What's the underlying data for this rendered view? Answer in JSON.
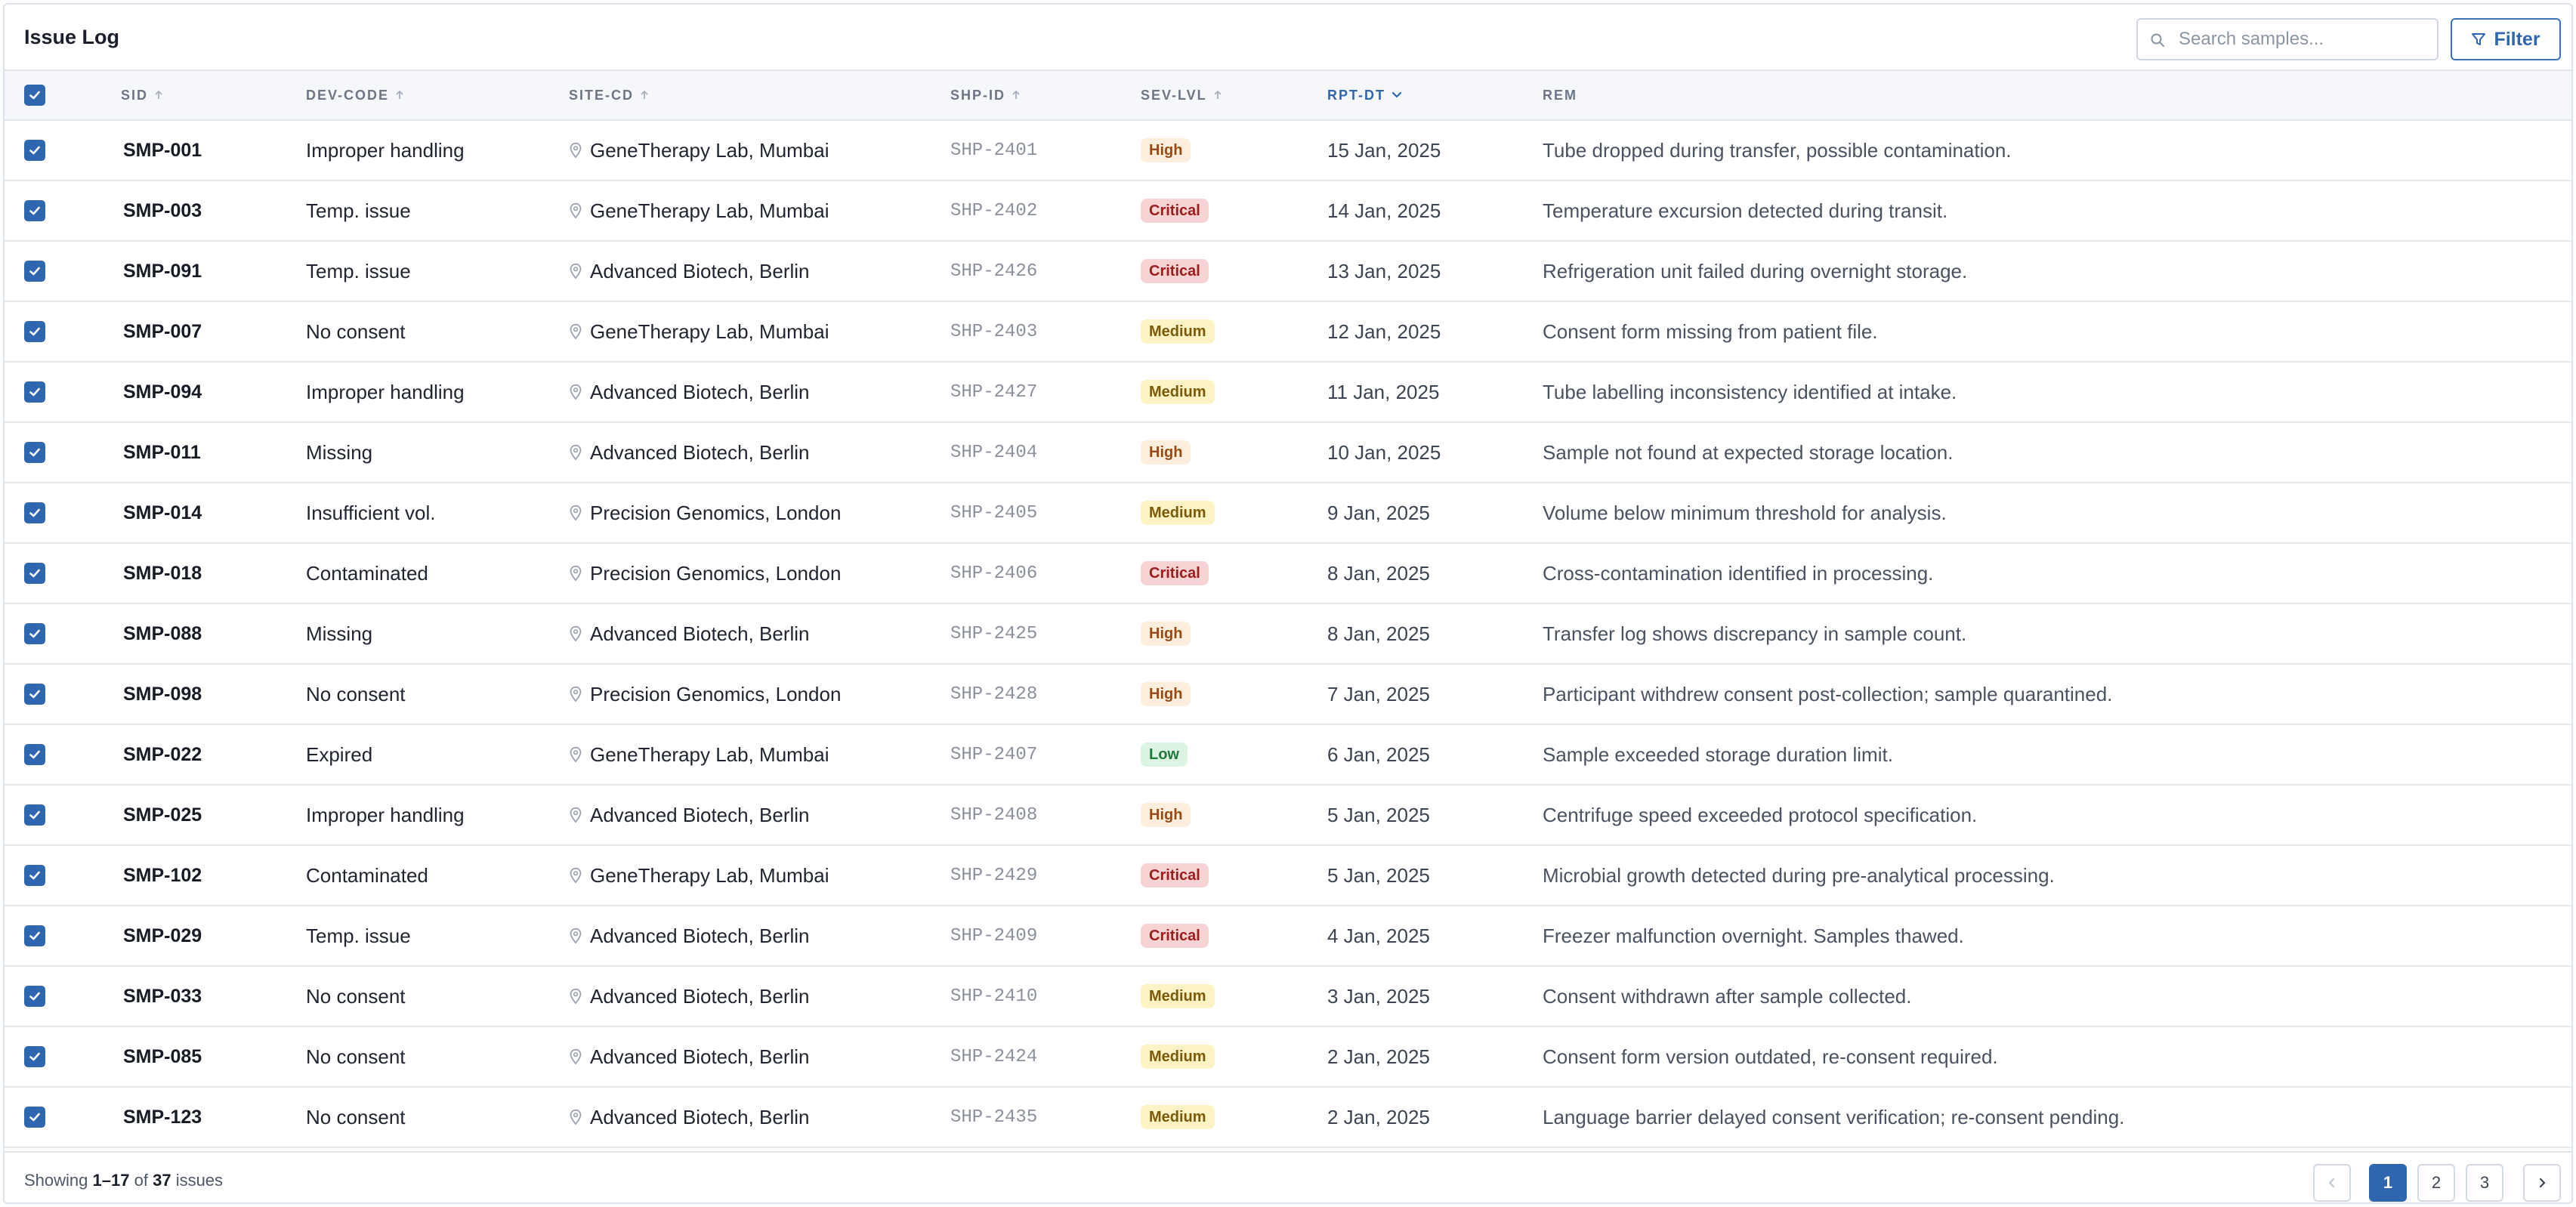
{
  "header": {
    "title": "Issue Log",
    "search_placeholder": "Search samples...",
    "filter_label": "Filter"
  },
  "columns": {
    "sid": "SID",
    "dev_code": "DEV-CODE",
    "site_cd": "SITE-CD",
    "shp_id": "SHP-ID",
    "sev_lvl": "SEV-LVL",
    "rpt_dt": "RPT-DT",
    "rem": "REM"
  },
  "sort": {
    "active_column": "RPT-DT",
    "direction": "descending"
  },
  "rows": [
    {
      "sid": "SMP-001",
      "dev": "Improper handling",
      "site": "GeneTherapy Lab, Mumbai",
      "shp": "SHP-2401",
      "sev": "High",
      "date": "15 Jan, 2025",
      "rem": "Tube dropped during transfer, possible contamination.",
      "checked": true
    },
    {
      "sid": "SMP-003",
      "dev": "Temp. issue",
      "site": "GeneTherapy Lab, Mumbai",
      "shp": "SHP-2402",
      "sev": "Critical",
      "date": "14 Jan, 2025",
      "rem": "Temperature excursion detected during transit.",
      "checked": true
    },
    {
      "sid": "SMP-091",
      "dev": "Temp. issue",
      "site": "Advanced Biotech, Berlin",
      "shp": "SHP-2426",
      "sev": "Critical",
      "date": "13 Jan, 2025",
      "rem": "Refrigeration unit failed during overnight storage.",
      "checked": true
    },
    {
      "sid": "SMP-007",
      "dev": "No consent",
      "site": "GeneTherapy Lab, Mumbai",
      "shp": "SHP-2403",
      "sev": "Medium",
      "date": "12 Jan, 2025",
      "rem": "Consent form missing from patient file.",
      "checked": true
    },
    {
      "sid": "SMP-094",
      "dev": "Improper handling",
      "site": "Advanced Biotech, Berlin",
      "shp": "SHP-2427",
      "sev": "Medium",
      "date": "11 Jan, 2025",
      "rem": "Tube labelling inconsistency identified at intake.",
      "checked": true
    },
    {
      "sid": "SMP-011",
      "dev": "Missing",
      "site": "Advanced Biotech, Berlin",
      "shp": "SHP-2404",
      "sev": "High",
      "date": "10 Jan, 2025",
      "rem": "Sample not found at expected storage location.",
      "checked": true
    },
    {
      "sid": "SMP-014",
      "dev": "Insufficient vol.",
      "site": "Precision Genomics, London",
      "shp": "SHP-2405",
      "sev": "Medium",
      "date": "9 Jan, 2025",
      "rem": "Volume below minimum threshold for analysis.",
      "checked": true
    },
    {
      "sid": "SMP-018",
      "dev": "Contaminated",
      "site": "Precision Genomics, London",
      "shp": "SHP-2406",
      "sev": "Critical",
      "date": "8 Jan, 2025",
      "rem": "Cross-contamination identified in processing.",
      "checked": true
    },
    {
      "sid": "SMP-088",
      "dev": "Missing",
      "site": "Advanced Biotech, Berlin",
      "shp": "SHP-2425",
      "sev": "High",
      "date": "8 Jan, 2025",
      "rem": "Transfer log shows discrepancy in sample count.",
      "checked": true
    },
    {
      "sid": "SMP-098",
      "dev": "No consent",
      "site": "Precision Genomics, London",
      "shp": "SHP-2428",
      "sev": "High",
      "date": "7 Jan, 2025",
      "rem": "Participant withdrew consent post-collection; sample quarantined.",
      "checked": true
    },
    {
      "sid": "SMP-022",
      "dev": "Expired",
      "site": "GeneTherapy Lab, Mumbai",
      "shp": "SHP-2407",
      "sev": "Low",
      "date": "6 Jan, 2025",
      "rem": "Sample exceeded storage duration limit.",
      "checked": true
    },
    {
      "sid": "SMP-025",
      "dev": "Improper handling",
      "site": "Advanced Biotech, Berlin",
      "shp": "SHP-2408",
      "sev": "High",
      "date": "5 Jan, 2025",
      "rem": "Centrifuge speed exceeded protocol specification.",
      "checked": true
    },
    {
      "sid": "SMP-102",
      "dev": "Contaminated",
      "site": "GeneTherapy Lab, Mumbai",
      "shp": "SHP-2429",
      "sev": "Critical",
      "date": "5 Jan, 2025",
      "rem": "Microbial growth detected during pre-analytical processing.",
      "checked": true
    },
    {
      "sid": "SMP-029",
      "dev": "Temp. issue",
      "site": "Advanced Biotech, Berlin",
      "shp": "SHP-2409",
      "sev": "Critical",
      "date": "4 Jan, 2025",
      "rem": "Freezer malfunction overnight. Samples thawed.",
      "checked": true
    },
    {
      "sid": "SMP-033",
      "dev": "No consent",
      "site": "Advanced Biotech, Berlin",
      "shp": "SHP-2410",
      "sev": "Medium",
      "date": "3 Jan, 2025",
      "rem": "Consent withdrawn after sample collected.",
      "checked": true
    },
    {
      "sid": "SMP-085",
      "dev": "No consent",
      "site": "Advanced Biotech, Berlin",
      "shp": "SHP-2424",
      "sev": "Medium",
      "date": "2 Jan, 2025",
      "rem": "Consent form version outdated, re-consent required.",
      "checked": true
    },
    {
      "sid": "SMP-123",
      "dev": "No consent",
      "site": "Advanced Biotech, Berlin",
      "shp": "SHP-2435",
      "sev": "Medium",
      "date": "2 Jan, 2025",
      "rem": "Language barrier delayed consent verification; re-consent pending.",
      "checked": true
    }
  ],
  "footer": {
    "showing_prefix": "Showing",
    "range": "1–17",
    "of": "of",
    "total": "37",
    "suffix": "issues"
  },
  "pagination": {
    "prev_icon": "chevron-left-icon",
    "pages": [
      "1",
      "2",
      "3"
    ],
    "current": "1",
    "next_icon": "chevron-right-icon"
  },
  "colors": {
    "accent": "#2e66b0",
    "high_bg": "#fdeedd",
    "critical_bg": "#f8d3d3",
    "medium_bg": "#fdf3c4",
    "low_bg": "#dcf5e3"
  }
}
